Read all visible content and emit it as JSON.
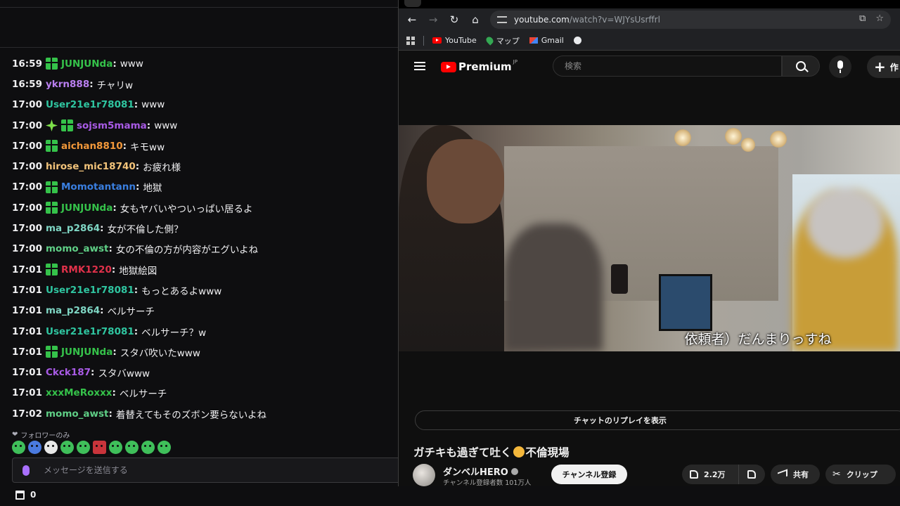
{
  "chat": {
    "messages": [
      {
        "time": "16:59",
        "badges": [
          "gift"
        ],
        "user": "JUNJUNda",
        "color": "#35c24a",
        "text": "www"
      },
      {
        "time": "16:59",
        "badges": [],
        "user": "ykrn888",
        "color": "#b97ff0",
        "text": "チャリw"
      },
      {
        "time": "17:00",
        "badges": [],
        "user": "User21e1r78081",
        "color": "#2fc5a0",
        "text": "www"
      },
      {
        "time": "17:00",
        "badges": [
          "star",
          "gift"
        ],
        "user": "sojsm5mama",
        "color": "#a95be6",
        "text": "www"
      },
      {
        "time": "17:00",
        "badges": [
          "gift"
        ],
        "user": "aichan8810",
        "color": "#f2983a",
        "text": "キモww"
      },
      {
        "time": "17:00",
        "badges": [],
        "user": "hirose_mic18740",
        "color": "#f2c37a",
        "text": "お疲れ様"
      },
      {
        "time": "17:00",
        "badges": [
          "gift"
        ],
        "user": "Momotantann",
        "color": "#3a7fe0",
        "text": "地獄"
      },
      {
        "time": "17:00",
        "badges": [
          "gift"
        ],
        "user": "JUNJUNda",
        "color": "#35c24a",
        "text": "女もヤバいやついっぱい居るよ"
      },
      {
        "time": "17:00",
        "badges": [],
        "user": "ma_p2864",
        "color": "#7fd6c4",
        "text": "女が不倫した側？"
      },
      {
        "time": "17:00",
        "badges": [],
        "user": "momo_awst",
        "color": "#5fcf86",
        "text": "女の不倫の方が内容がエグいよね"
      },
      {
        "time": "17:01",
        "badges": [
          "gift"
        ],
        "user": "RMK1220",
        "color": "#e0314a",
        "text": "地獄絵図"
      },
      {
        "time": "17:01",
        "badges": [],
        "user": "User21e1r78081",
        "color": "#2fc5a0",
        "text": "もっとあるよwww"
      },
      {
        "time": "17:01",
        "badges": [],
        "user": "ma_p2864",
        "color": "#7fd6c4",
        "text": "ベルサーチ"
      },
      {
        "time": "17:01",
        "badges": [],
        "user": "User21e1r78081",
        "color": "#2fc5a0",
        "text": "ベルサーチ？w"
      },
      {
        "time": "17:01",
        "badges": [
          "gift"
        ],
        "user": "JUNJUNda",
        "color": "#35c24a",
        "text": "スタバ吹いたwww"
      },
      {
        "time": "17:01",
        "badges": [],
        "user": "Ckck187",
        "color": "#a95be6",
        "text": "スタバwww"
      },
      {
        "time": "17:01",
        "badges": [],
        "user": "xxxMeRoxxx",
        "color": "#35c24a",
        "text": "ベルサーチ"
      },
      {
        "time": "17:02",
        "badges": [],
        "user": "momo_awst",
        "color": "#5fcf86",
        "text": "着替えてもそのズボン要らないよね"
      }
    ],
    "followers_only": "フォロワーのみ",
    "emotes": [
      "green-face",
      "blue-face",
      "white-face",
      "green-face",
      "green-face",
      "red-face",
      "green-face",
      "green-face",
      "green-face",
      "green-face"
    ],
    "input_placeholder": "メッセージを送信する",
    "points": "0"
  },
  "browser": {
    "url_host": "youtube.com",
    "url_path": "/watch?v=WJYsUsrffrl",
    "bookmarks": [
      {
        "label": "YouTube",
        "icon": "youtube-icon"
      },
      {
        "label": "マップ",
        "icon": "maps-icon"
      },
      {
        "label": "Gmail",
        "icon": "gmail-icon"
      }
    ]
  },
  "youtube": {
    "logo": "Premium",
    "region": "JP",
    "search_placeholder": "検索",
    "create_label": "作",
    "subtitle": "依頼者）だんまりっすね",
    "replay_label": "チャットのリプレイを表示",
    "title_before": "ガチキも過ぎて吐く",
    "title_after": "不倫現場",
    "channel_name": "ダンベルHERO",
    "subscribers": "チャンネル登録者数 101万人",
    "subscribe_label": "チャンネル登録",
    "likes": "2.2万",
    "share_label": "共有",
    "clip_label": "クリップ"
  }
}
